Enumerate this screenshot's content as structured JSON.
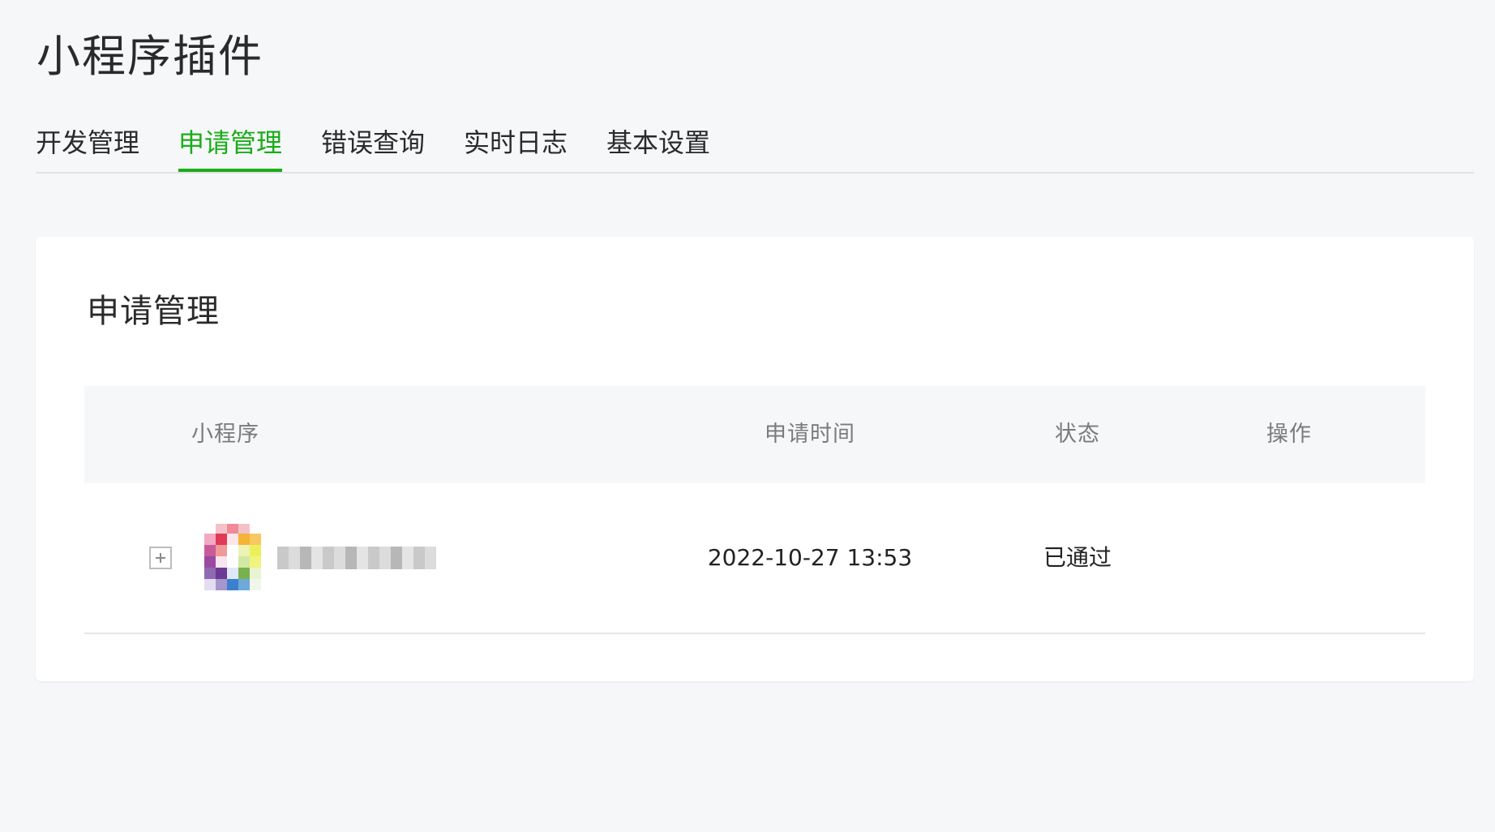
{
  "page": {
    "title": "小程序插件"
  },
  "tabs": [
    {
      "label": "开发管理",
      "active": false
    },
    {
      "label": "申请管理",
      "active": true
    },
    {
      "label": "错误查询",
      "active": false
    },
    {
      "label": "实时日志",
      "active": false
    },
    {
      "label": "基本设置",
      "active": false
    }
  ],
  "card": {
    "title": "申请管理",
    "table": {
      "headers": {
        "app": "小程序",
        "time": "申请时间",
        "status": "状态",
        "action": "操作"
      },
      "rows": [
        {
          "app_name": "",
          "avatar_icon": "blurred-app-avatar-icon",
          "time": "2022-10-27 13:53",
          "status": "已通过",
          "action": ""
        }
      ]
    }
  },
  "colors": {
    "accent": "#1aad19",
    "background": "#f6f7f9"
  }
}
